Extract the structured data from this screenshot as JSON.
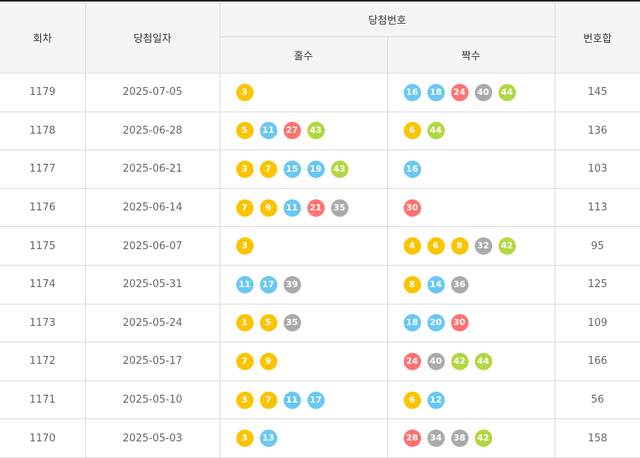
{
  "headers": {
    "round": "회차",
    "date": "당첨일자",
    "winning_numbers": "당첨번호",
    "odd": "홀수",
    "even": "짝수",
    "sum": "번호합"
  },
  "colors": {
    "yellow": "#fbc400",
    "blue": "#69c8f2",
    "red": "#ff7272",
    "gray": "#aaaaaa",
    "green": "#b0d840",
    "header_bg": "#f5f5f5",
    "border": "#dcdcdc"
  },
  "rows": [
    {
      "round": "1179",
      "date": "2025-07-05",
      "odd": [
        "3"
      ],
      "even": [
        "16",
        "18",
        "24",
        "40",
        "44"
      ],
      "sum": "145"
    },
    {
      "round": "1178",
      "date": "2025-06-28",
      "odd": [
        "5",
        "11",
        "27",
        "43"
      ],
      "even": [
        "6",
        "44"
      ],
      "sum": "136"
    },
    {
      "round": "1177",
      "date": "2025-06-21",
      "odd": [
        "3",
        "7",
        "15",
        "19",
        "43"
      ],
      "even": [
        "16"
      ],
      "sum": "103"
    },
    {
      "round": "1176",
      "date": "2025-06-14",
      "odd": [
        "7",
        "9",
        "11",
        "21",
        "35"
      ],
      "even": [
        "30"
      ],
      "sum": "113"
    },
    {
      "round": "1175",
      "date": "2025-06-07",
      "odd": [
        "3"
      ],
      "even": [
        "4",
        "6",
        "8",
        "32",
        "42"
      ],
      "sum": "95"
    },
    {
      "round": "1174",
      "date": "2025-05-31",
      "odd": [
        "11",
        "17",
        "39"
      ],
      "even": [
        "8",
        "14",
        "36"
      ],
      "sum": "125"
    },
    {
      "round": "1173",
      "date": "2025-05-24",
      "odd": [
        "1",
        "5",
        "35"
      ],
      "even": [
        "18",
        "20",
        "30"
      ],
      "sum": "109"
    },
    {
      "round": "1172",
      "date": "2025-05-17",
      "odd": [
        "7",
        "9"
      ],
      "even": [
        "24",
        "40",
        "42",
        "44"
      ],
      "sum": "166"
    },
    {
      "round": "1171",
      "date": "2025-05-10",
      "odd": [
        "3",
        "7",
        "11",
        "17"
      ],
      "even": [
        "6",
        "12"
      ],
      "sum": "56"
    },
    {
      "round": "1170",
      "date": "2025-05-03",
      "odd": [
        "3",
        "13"
      ],
      "even": [
        "28",
        "34",
        "38",
        "42"
      ],
      "sum": "158"
    }
  ]
}
